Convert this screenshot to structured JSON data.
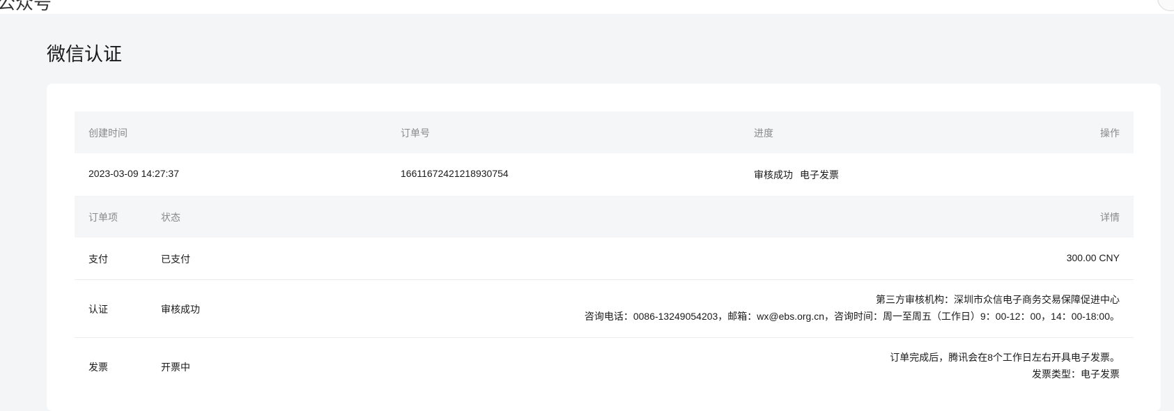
{
  "topbar": {
    "title_fragment": "公众号"
  },
  "page": {
    "title": "微信认证"
  },
  "order_table": {
    "headers": {
      "created_time": "创建时间",
      "order_no": "订单号",
      "progress": "进度",
      "action": "操作"
    },
    "row": {
      "created_time": "2023-03-09 14:27:37",
      "order_no": "1661167242121893 0754",
      "progress_status": "审核成功",
      "progress_invoice": "电子发票",
      "action": ""
    }
  },
  "items_table": {
    "headers": {
      "item": "订单项",
      "status": "状态",
      "detail": "详情"
    },
    "rows": [
      {
        "item": "支付",
        "status": "已支付",
        "detail_lines": [
          "300.00 CNY"
        ]
      },
      {
        "item": "认证",
        "status": "审核成功",
        "detail_lines": [
          "第三方审核机构：深圳市众信电子商务交易保障促进中心",
          "咨询电话：0086-13249054203，邮箱：wx@ebs.org.cn，咨询时间：周一至周五（工作日）9：00-12：00，14：00-18:00。"
        ]
      },
      {
        "item": "发票",
        "status": "开票中",
        "detail_lines": [
          "订单完成后，腾讯会在8个工作日左右开具电子发票。",
          "发票类型：电子发票"
        ]
      }
    ]
  }
}
